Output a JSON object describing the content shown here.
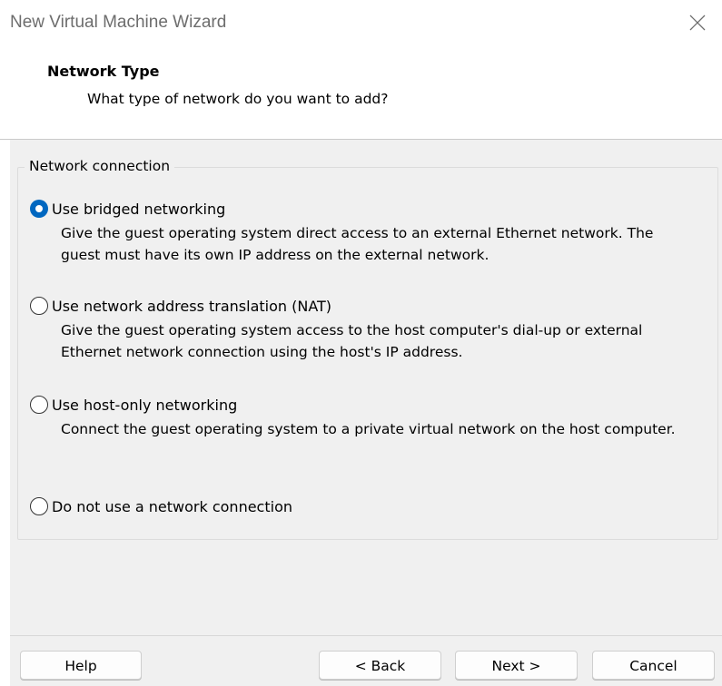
{
  "window": {
    "title": "New Virtual Machine Wizard"
  },
  "header": {
    "title": "Network Type",
    "subtitle": "What type of network do you want to add?"
  },
  "group": {
    "legend": "Network connection",
    "options": [
      {
        "label": "Use bridged networking",
        "description": "Give the guest operating system direct access to an external Ethernet network. The guest must have its own IP address on the external network.",
        "checked": true
      },
      {
        "label": "Use network address translation (NAT)",
        "description": "Give the guest operating system access to the host computer's dial-up or external Ethernet network connection using the host's IP address.",
        "checked": false
      },
      {
        "label": "Use host-only networking",
        "description": "Connect the guest operating system to a private virtual network on the host computer.",
        "checked": false
      },
      {
        "label": "Do not use a network connection",
        "description": "",
        "checked": false
      }
    ]
  },
  "footer": {
    "help_label": "Help",
    "back_label": "< Back",
    "next_label": "Next >",
    "cancel_label": "Cancel"
  },
  "colors": {
    "accent": "#0067c0",
    "panel_background": "#f0f0f0",
    "title_text": "#6d6d6d"
  },
  "icons": {
    "close": "close-icon"
  }
}
